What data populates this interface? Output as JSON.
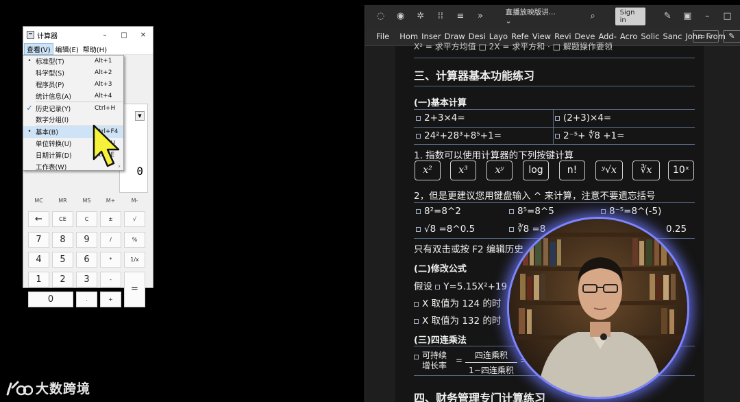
{
  "calculator": {
    "title": "计算器",
    "window_controls": [
      "–",
      "□",
      "✕"
    ],
    "menubar": [
      "查看(V)",
      "编辑(E)",
      "帮助(H)"
    ],
    "display_value": "0",
    "memory_keys": [
      "MC",
      "MR",
      "MS",
      "M+",
      "M-"
    ],
    "keys": [
      [
        "←",
        "CE",
        "C",
        "±",
        "√"
      ],
      [
        "7",
        "8",
        "9",
        "/",
        "%"
      ],
      [
        "4",
        "5",
        "6",
        "*",
        "1/x"
      ],
      [
        "1",
        "2",
        "3",
        "-",
        "="
      ],
      [
        "0",
        ".",
        "+"
      ]
    ],
    "view_menu": [
      {
        "mark": "•",
        "label": "标准型(T)",
        "shortcut": "Alt+1"
      },
      {
        "mark": "",
        "label": "科学型(S)",
        "shortcut": "Alt+2"
      },
      {
        "mark": "",
        "label": "程序员(P)",
        "shortcut": "Alt+3"
      },
      {
        "mark": "",
        "label": "统计信息(A)",
        "shortcut": "Alt+4"
      },
      {
        "mark": "✓",
        "label": "历史记录(Y)",
        "shortcut": "Ctrl+H"
      },
      {
        "mark": "",
        "label": "数字分组(I)",
        "shortcut": ""
      },
      {
        "mark": "•",
        "label": "基本(B)",
        "shortcut": "Ctrl+F4"
      },
      {
        "mark": "",
        "label": "单位转换(U)",
        "shortcut": "Ctrl+U"
      },
      {
        "mark": "",
        "label": "日期计算(D)",
        "shortcut": "Ctrl+E"
      },
      {
        "mark": "",
        "label": "工作表(W)",
        "shortcut": "›"
      }
    ]
  },
  "logo": {
    "name": "大数跨境"
  },
  "notes_window": {
    "doc_title": "直播放映版讲...",
    "doc_title_chevron": "⌄",
    "sign_in": "Sign in",
    "ribbon_tabs": [
      "File",
      "Hom",
      "Inser",
      "Draw",
      "Desi",
      "Layo",
      "Refe",
      "View",
      "Revi",
      "Deve",
      "Add-",
      "Acro",
      "Solic",
      "Sanc",
      "John",
      "From"
    ],
    "top_cut_text": "X² = 求平方均值   □ 2X = 求平方和   · □ 解题操作要领",
    "section3_title": "三、计算器基本功能练习",
    "sub1_title": "(一)基本计算",
    "calc_items": [
      "2+3×4=",
      "(2+3)×4=",
      "24²+28³+8⁵+1=",
      "2⁻⁵+ ∜8 +1="
    ],
    "exponent_note": "1. 指数可以使用计算器的下列按键计算",
    "calc_keys": [
      "x²",
      "x³",
      "xʸ",
      "log",
      "n!",
      "ʸ√x",
      "∛x",
      "10ˣ"
    ],
    "keyboard_note": "2，但是更建议您用键盘输入 ^ 来计算，注意不要遗忘括号",
    "kbd_examples": [
      "8²=8^2",
      "8⁵=8^5",
      "8⁻⁵=8^(-5)",
      "√8 =8^0.5",
      "∛8 =8",
      "0.25"
    ],
    "history_note": "只有双击或按 F2 编辑历史",
    "sub2_title": "(二)修改公式",
    "suppose": "假设",
    "formula": "Y=5.15X²+19",
    "x_124": "X 取值为 124 的时",
    "x_132": "X 取值为 132 的时",
    "sub3_title": "(三)四连乘法",
    "sustain_label": [
      "可持续",
      "增长率"
    ],
    "frac_num": "四连乘积",
    "frac_den": "1−四连乘积",
    "frac_eq2": "= 1",
    "section4_title": "四、财务管理专门计算练习"
  }
}
